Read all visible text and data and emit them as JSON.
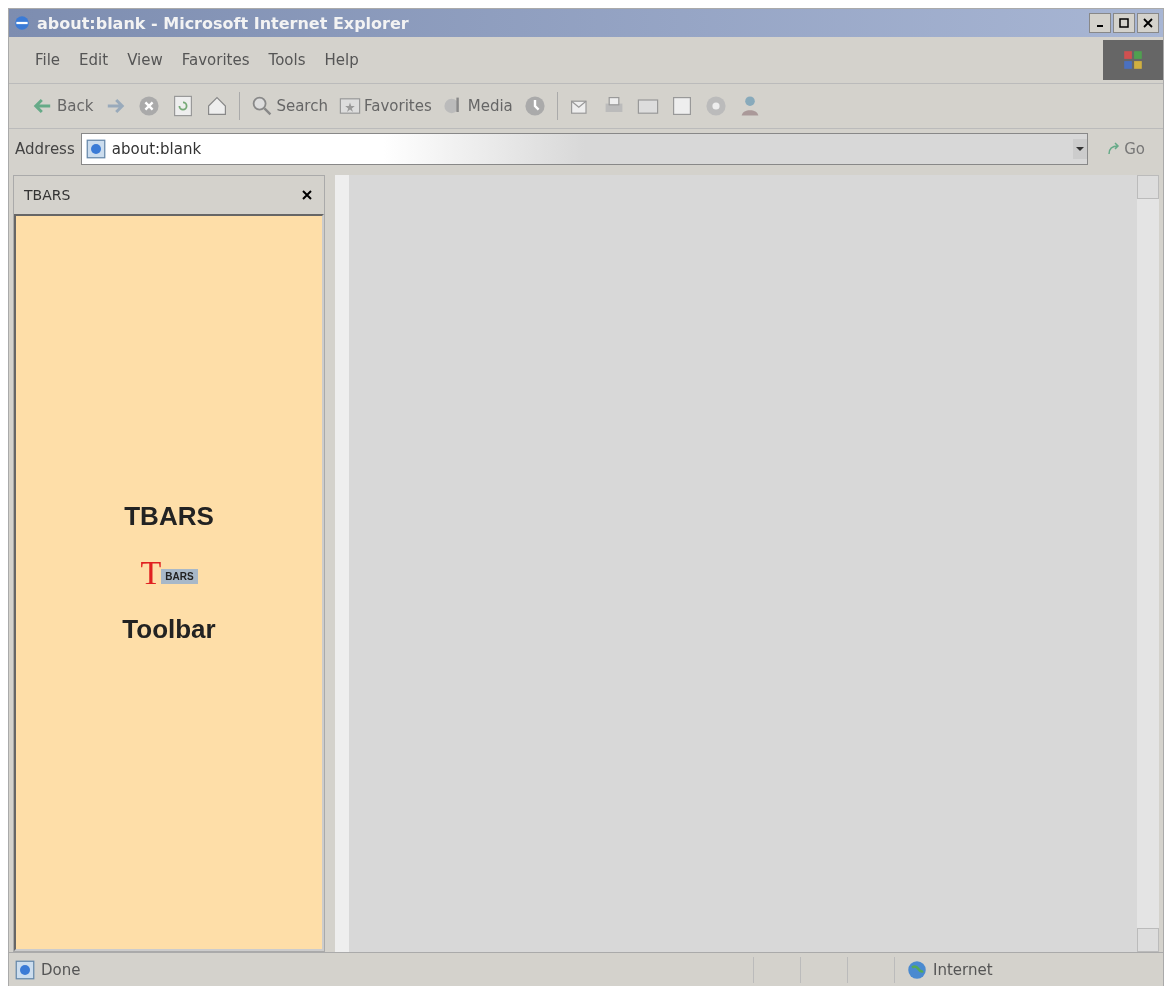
{
  "window": {
    "title": "about:blank - Microsoft Internet Explorer"
  },
  "menu": [
    "File",
    "Edit",
    "View",
    "Favorites",
    "Tools",
    "Help"
  ],
  "toolbar": [
    {
      "kind": "back",
      "label": "Back"
    },
    {
      "kind": "forward"
    },
    {
      "kind": "stop"
    },
    {
      "kind": "refresh"
    },
    {
      "kind": "home"
    },
    {
      "kind": "search",
      "label": "Search"
    },
    {
      "kind": "favorites",
      "label": "Favorites"
    },
    {
      "kind": "media",
      "label": "Media"
    },
    {
      "kind": "history"
    },
    {
      "kind": "mail"
    },
    {
      "kind": "print"
    },
    {
      "kind": "edit"
    },
    {
      "kind": "discuss"
    },
    {
      "kind": "messenger"
    },
    {
      "kind": "user"
    }
  ],
  "address": {
    "label": "Address",
    "value": "about:blank",
    "go": "Go"
  },
  "sidebar": {
    "title": "TBARS",
    "heading": "TBARS",
    "logo": {
      "big": "T",
      "small": "BARS"
    },
    "subheading": "Toolbar"
  },
  "status_bar": {
    "text": "Done",
    "zone": "Internet"
  }
}
